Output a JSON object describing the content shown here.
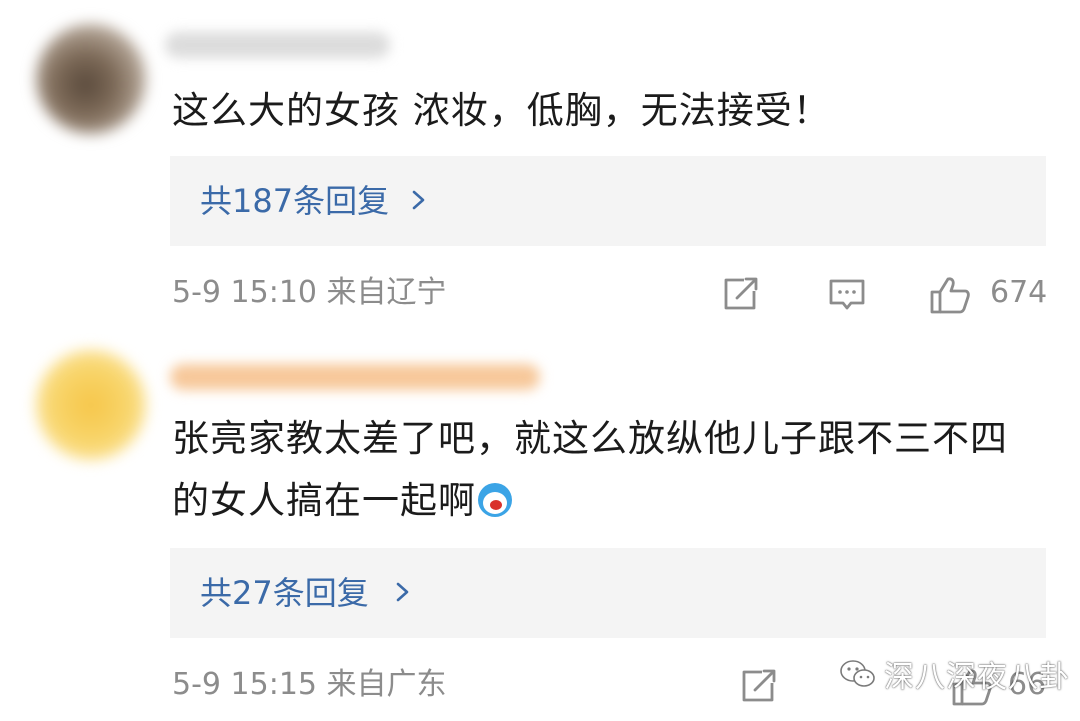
{
  "comments": [
    {
      "text": "这么大的女孩 浓妆，低胸，无法接受！",
      "replies_label": "共187条回复",
      "timestamp": "5-9 15:10",
      "location": "来自辽宁",
      "likes": "674"
    },
    {
      "text": "张亮家教太差了吧，就这么放纵他儿子跟不三不四的女人搞在一起啊",
      "replies_label": "共27条回复",
      "timestamp": "5-9 15:15",
      "location": "来自广东",
      "likes": "66"
    }
  ],
  "watermark": {
    "text": "深八深夜八卦",
    "icon": "wechat-icon"
  },
  "colors": {
    "reply_link": "#3b6aa8",
    "meta_gray": "#8c8c8c",
    "reply_box_bg": "#f4f4f4"
  },
  "icons": [
    "share-icon",
    "comment-icon",
    "like-icon",
    "chevron-right-icon",
    "doraemon-emoji"
  ]
}
